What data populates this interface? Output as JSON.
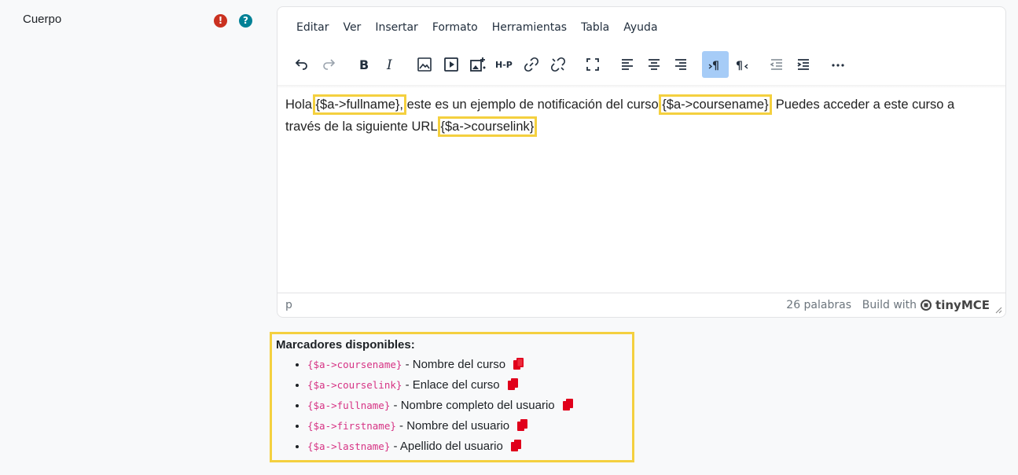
{
  "field": {
    "label": "Cuerpo"
  },
  "icons": {
    "required": "!",
    "help": "?"
  },
  "menubar": [
    "Editar",
    "Ver",
    "Insertar",
    "Formato",
    "Herramientas",
    "Tabla",
    "Ayuda"
  ],
  "toolbar": [
    "undo-icon",
    "redo-icon",
    "bold-icon",
    "italic-icon",
    "image-icon",
    "media-icon",
    "media-plus-icon",
    "h5p-icon",
    "link-icon",
    "unlink-icon",
    "fullscreen-icon",
    "align-left-icon",
    "align-center-icon",
    "align-right-icon",
    "ltr-icon",
    "rtl-icon",
    "outdent-icon",
    "indent-icon",
    "more-icon"
  ],
  "content": {
    "t1": "Hola ",
    "ph1": "{$a->fullname},",
    "t2": " este es un ejemplo de notificación del curso ",
    "ph2": "{$a->coursename}",
    "t3": ". Puedes acceder a este curso a través de la siguiente URL ",
    "ph3": "{$a->courselink}",
    "t4": "."
  },
  "statusbar": {
    "path": "p",
    "wordcount": "26 palabras",
    "build": "Build with",
    "brand": "tinyMCE"
  },
  "markers": {
    "title": "Marcadores disponibles:",
    "items": [
      {
        "code": "{$a->coursename}",
        "desc": " - Nombre del curso"
      },
      {
        "code": "{$a->courselink}",
        "desc": " - Enlace del curso"
      },
      {
        "code": "{$a->fullname}",
        "desc": " - Nombre completo del usuario"
      },
      {
        "code": "{$a->firstname}",
        "desc": " - Nombre del usuario"
      },
      {
        "code": "{$a->lastname}",
        "desc": " - Apellido del usuario"
      }
    ]
  },
  "colors": {
    "highlight": "#f4d03f",
    "required": "#ca3120",
    "help": "#008196",
    "code": "#d63384",
    "copy": "#e0001b"
  }
}
